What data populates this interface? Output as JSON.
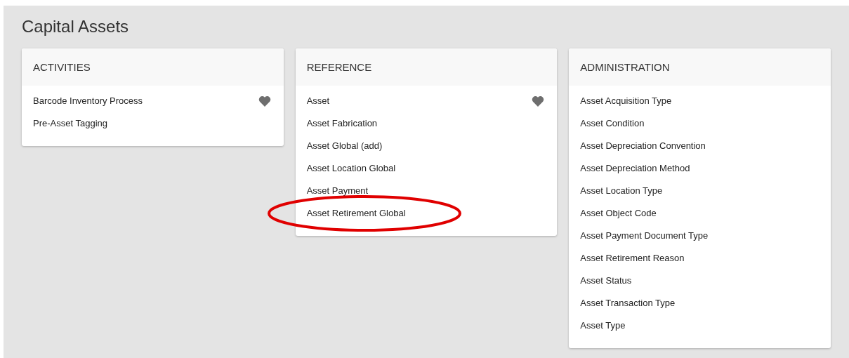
{
  "page": {
    "title": "Capital Assets"
  },
  "panels": [
    {
      "title": "ACTIVITIES",
      "items": [
        {
          "label": "Barcode Inventory Process",
          "favorite": true,
          "circled": false
        },
        {
          "label": "Pre-Asset Tagging",
          "favorite": false,
          "circled": false
        }
      ]
    },
    {
      "title": "REFERENCE",
      "items": [
        {
          "label": "Asset",
          "favorite": true,
          "circled": false
        },
        {
          "label": "Asset Fabrication",
          "favorite": false,
          "circled": false
        },
        {
          "label": "Asset Global (add)",
          "favorite": false,
          "circled": false
        },
        {
          "label": "Asset Location Global",
          "favorite": false,
          "circled": false
        },
        {
          "label": "Asset Payment",
          "favorite": false,
          "circled": false
        },
        {
          "label": "Asset Retirement Global",
          "favorite": false,
          "circled": true
        }
      ]
    },
    {
      "title": "ADMINISTRATION",
      "items": [
        {
          "label": "Asset Acquisition Type",
          "favorite": false,
          "circled": false
        },
        {
          "label": "Asset Condition",
          "favorite": false,
          "circled": false
        },
        {
          "label": "Asset Depreciation Convention",
          "favorite": false,
          "circled": false
        },
        {
          "label": "Asset Depreciation Method",
          "favorite": false,
          "circled": false
        },
        {
          "label": "Asset Location Type",
          "favorite": false,
          "circled": false
        },
        {
          "label": "Asset Object Code",
          "favorite": false,
          "circled": false
        },
        {
          "label": "Asset Payment Document Type",
          "favorite": false,
          "circled": false
        },
        {
          "label": "Asset Retirement Reason",
          "favorite": false,
          "circled": false
        },
        {
          "label": "Asset Status",
          "favorite": false,
          "circled": false
        },
        {
          "label": "Asset Transaction Type",
          "favorite": false,
          "circled": false
        },
        {
          "label": "Asset Type",
          "favorite": false,
          "circled": false
        }
      ]
    }
  ]
}
